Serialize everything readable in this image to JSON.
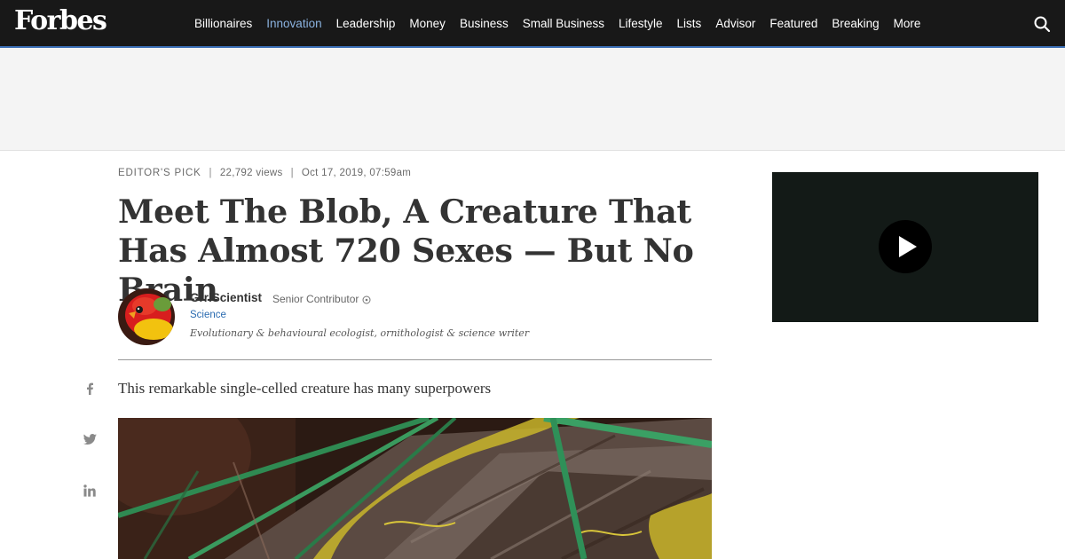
{
  "header": {
    "logo": "Forbes",
    "nav": [
      {
        "label": "Billionaires",
        "active": false
      },
      {
        "label": "Innovation",
        "active": true
      },
      {
        "label": "Leadership",
        "active": false
      },
      {
        "label": "Money",
        "active": false
      },
      {
        "label": "Business",
        "active": false
      },
      {
        "label": "Small Business",
        "active": false
      },
      {
        "label": "Lifestyle",
        "active": false
      },
      {
        "label": "Lists",
        "active": false
      },
      {
        "label": "Advisor",
        "active": false
      },
      {
        "label": "Featured",
        "active": false
      },
      {
        "label": "Breaking",
        "active": false
      },
      {
        "label": "More",
        "active": false
      }
    ],
    "search_icon": "search-icon",
    "accent_color": "#8bb3e0"
  },
  "article": {
    "editors_pick": "EDITOR'S PICK",
    "separator": "|",
    "views": "22,792 views",
    "date": "Oct 17, 2019, 07:59am",
    "headline": "Meet The Blob, A Creature That Has Almost 720 Sexes — But No Brain",
    "author": {
      "name": "GrrlScientist",
      "role": "Senior Contributor",
      "role_icon": "info-icon",
      "section": "Science",
      "bio": "Evolutionary & behavioural ecologist, ornithologist & science writer",
      "section_color": "#2a6bb0"
    },
    "dek": "This remarkable single-celled creature has many superpowers"
  },
  "social": {
    "icons": [
      "facebook-icon",
      "twitter-icon",
      "linkedin-icon"
    ]
  },
  "video": {
    "play_icon": "play-icon"
  }
}
